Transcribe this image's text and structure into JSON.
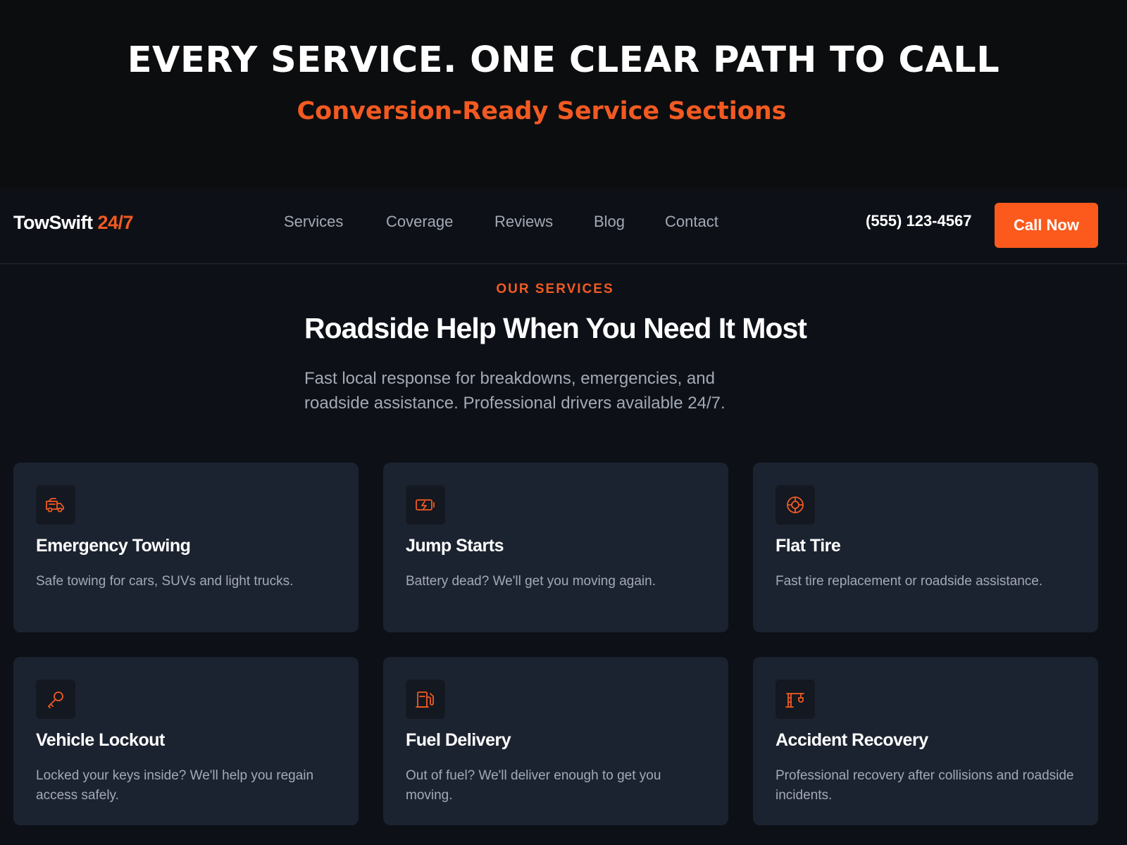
{
  "banner": {
    "title": "EVERY SERVICE. ONE CLEAR PATH TO CALL",
    "subtitle": "Conversion-Ready Service Sections"
  },
  "header": {
    "logo_name": "TowSwift",
    "logo_accent": "24/7",
    "nav": [
      "Services",
      "Coverage",
      "Reviews",
      "Blog",
      "Contact"
    ],
    "phone": "(555) 123-4567",
    "cta_label": "Call Now"
  },
  "services_section": {
    "eyebrow": "OUR SERVICES",
    "heading": "Roadside Help When You Need It Most",
    "description": "Fast local response for breakdowns, emergencies, and roadside assistance. Professional drivers available 24/7.",
    "cards": [
      {
        "icon": "tow-truck-icon",
        "title": "Emergency Towing",
        "description": "Safe towing for cars, SUVs and light trucks."
      },
      {
        "icon": "battery-charging-icon",
        "title": "Jump Starts",
        "description": "Battery dead? We'll get you moving again."
      },
      {
        "icon": "tire-icon",
        "title": "Flat Tire",
        "description": "Fast tire replacement or roadside assistance."
      },
      {
        "icon": "key-icon",
        "title": "Vehicle Lockout",
        "description": "Locked your keys inside? We'll help you regain access safely."
      },
      {
        "icon": "fuel-pump-icon",
        "title": "Fuel Delivery",
        "description": "Out of fuel? We'll deliver enough to get you moving."
      },
      {
        "icon": "crane-recovery-icon",
        "title": "Accident Recovery",
        "description": "Professional recovery after collisions and roadside incidents."
      }
    ]
  },
  "colors": {
    "accent": "#f25a22",
    "button": "#fb5a1c",
    "page_bg": "#0d1117",
    "card_bg": "#1c2330",
    "muted_text": "#a3a9b5"
  }
}
